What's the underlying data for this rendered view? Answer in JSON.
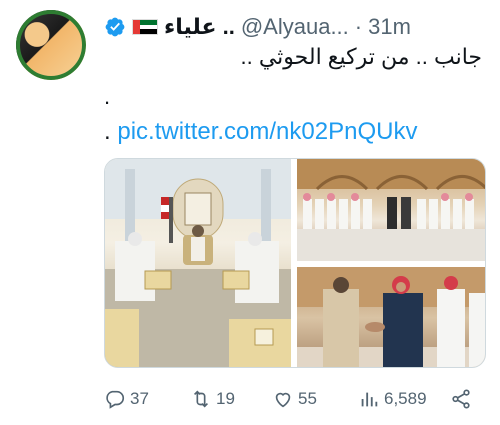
{
  "tweet": {
    "display_name": "علياء ..",
    "handle": "@Alyaua...",
    "separator": "·",
    "time": "31m",
    "text_line_1": "جانب .. من تركيع الحوثي ..",
    "text_line_2": ".",
    "link_prefix": ". ",
    "link_text": "pic.twitter.com/nk02PnQUkv"
  },
  "actions": {
    "replies": "37",
    "retweets": "19",
    "likes": "55",
    "views": "6,589"
  },
  "colors": {
    "link": "#1d9bf0",
    "muted": "#536471",
    "verified": "#1d9bf0"
  },
  "icons": [
    "verified-badge-icon",
    "uae-flag-icon",
    "reply-icon",
    "retweet-icon",
    "like-icon",
    "views-icon",
    "share-icon"
  ]
}
